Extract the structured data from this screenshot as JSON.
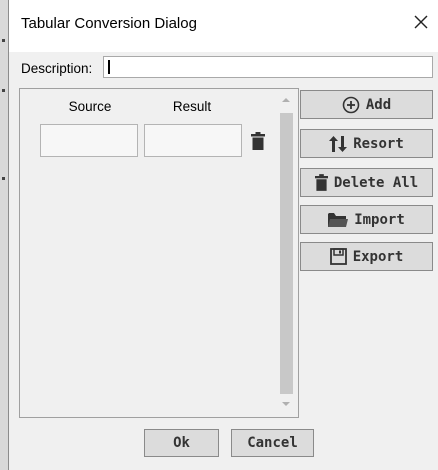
{
  "dialog": {
    "title": "Tabular Conversion Dialog"
  },
  "description": {
    "label": "Description:",
    "value": ""
  },
  "table": {
    "columns": [
      "Source",
      "Result"
    ],
    "rows": [
      {
        "source": "",
        "result": ""
      }
    ]
  },
  "side_buttons": {
    "add": "Add",
    "resort": "Resort",
    "delete_all": "Delete All",
    "import": "Import",
    "export": "Export"
  },
  "bottom_buttons": {
    "ok": "Ok",
    "cancel": "Cancel"
  },
  "icons": {
    "close": "close-icon",
    "add": "plus-circle-icon",
    "resort": "sort-arrows-icon",
    "trash": "trash-icon",
    "import": "folder-icon",
    "export": "floppy-disk-icon"
  }
}
